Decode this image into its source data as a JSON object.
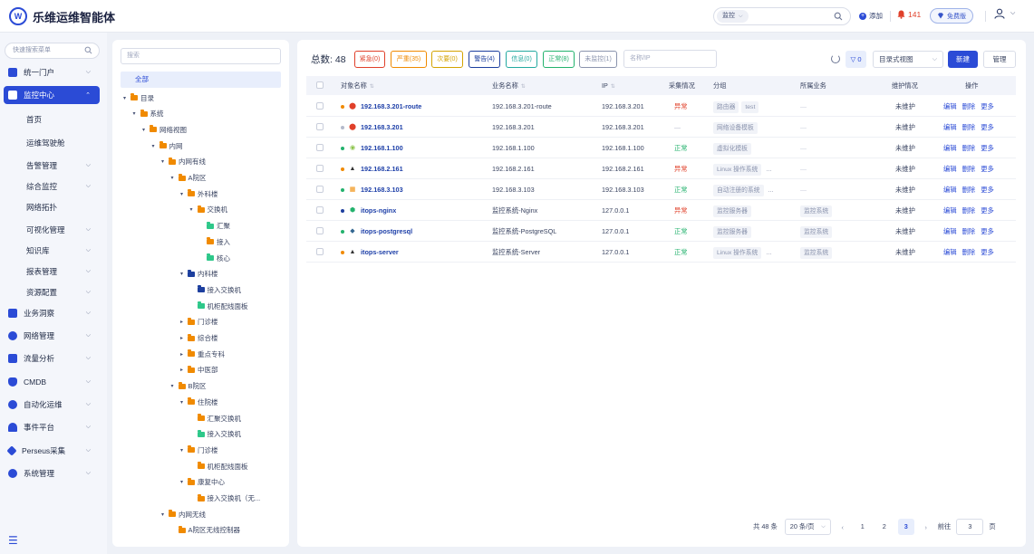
{
  "app": {
    "title": "乐维运维智能体",
    "logo_letter": "W"
  },
  "topbar": {
    "search_scope": "监控",
    "add_label": "添加",
    "alert_count": "141",
    "free_label": "免费版"
  },
  "leftnav": {
    "search_placeholder": "快速搜索菜单",
    "items": [
      {
        "label": "统一门户",
        "icon": "portal-icon",
        "has_children": true
      },
      {
        "label": "监控中心",
        "icon": "monitor-icon",
        "has_children": true,
        "active": true
      },
      {
        "label": "业务洞察",
        "icon": "insight-icon",
        "has_children": true
      },
      {
        "label": "网络管理",
        "icon": "network-icon",
        "has_children": true
      },
      {
        "label": "流量分析",
        "icon": "traffic-icon",
        "has_children": true
      },
      {
        "label": "CMDB",
        "icon": "cmdb-icon",
        "has_children": true
      },
      {
        "label": "自动化运维",
        "icon": "automation-icon",
        "has_children": true
      },
      {
        "label": "事件平台",
        "icon": "bell-icon",
        "has_children": true
      },
      {
        "label": "Perseus采集",
        "icon": "diamond-icon",
        "has_children": true
      },
      {
        "label": "系统管理",
        "icon": "gear-icon",
        "has_children": true
      }
    ],
    "sub_items": [
      {
        "label": "首页",
        "has_children": false
      },
      {
        "label": "运维驾驶舱",
        "has_children": false
      },
      {
        "label": "告警管理",
        "has_children": true
      },
      {
        "label": "综合监控",
        "has_children": true
      },
      {
        "label": "网络拓扑",
        "has_children": false
      },
      {
        "label": "可视化管理",
        "has_children": true
      },
      {
        "label": "知识库",
        "has_children": true
      },
      {
        "label": "报表管理",
        "has_children": true
      },
      {
        "label": "资源配置",
        "has_children": true
      }
    ]
  },
  "tree": {
    "search_placeholder": "搜索",
    "all_label": "全部",
    "nodes": [
      {
        "label": "目录",
        "level": 0,
        "expanded": true,
        "color": "orange"
      },
      {
        "label": "系统",
        "level": 1,
        "expanded": true,
        "color": "orange"
      },
      {
        "label": "网络视图",
        "level": 2,
        "expanded": true,
        "color": "orange"
      },
      {
        "label": "内网",
        "level": 3,
        "expanded": true,
        "color": "orange"
      },
      {
        "label": "内网有线",
        "level": 4,
        "expanded": true,
        "color": "orange"
      },
      {
        "label": "A院区",
        "level": 5,
        "expanded": true,
        "color": "orange"
      },
      {
        "label": "外科楼",
        "level": 6,
        "expanded": true,
        "color": "orange"
      },
      {
        "label": "交换机",
        "level": 7,
        "expanded": true,
        "color": "orange"
      },
      {
        "label": "汇聚",
        "level": 8,
        "expanded": null,
        "color": "green"
      },
      {
        "label": "接入",
        "level": 8,
        "expanded": null,
        "color": "orange"
      },
      {
        "label": "核心",
        "level": 8,
        "expanded": null,
        "color": "green"
      },
      {
        "label": "内科楼",
        "level": 6,
        "expanded": true,
        "color": "navy"
      },
      {
        "label": "接入交换机",
        "level": 7,
        "expanded": null,
        "color": "navy"
      },
      {
        "label": "机柜配线面板",
        "level": 7,
        "expanded": null,
        "color": "green"
      },
      {
        "label": "门诊楼",
        "level": 6,
        "expanded": false,
        "color": "orange"
      },
      {
        "label": "综合楼",
        "level": 6,
        "expanded": false,
        "color": "orange"
      },
      {
        "label": "重点专科",
        "level": 6,
        "expanded": false,
        "color": "orange"
      },
      {
        "label": "中医部",
        "level": 6,
        "expanded": false,
        "color": "orange"
      },
      {
        "label": "B院区",
        "level": 5,
        "expanded": true,
        "color": "orange"
      },
      {
        "label": "住院楼",
        "level": 6,
        "expanded": true,
        "color": "orange"
      },
      {
        "label": "汇聚交换机",
        "level": 7,
        "expanded": null,
        "color": "orange"
      },
      {
        "label": "接入交换机",
        "level": 7,
        "expanded": null,
        "color": "green"
      },
      {
        "label": "门诊楼",
        "level": 6,
        "expanded": true,
        "color": "orange"
      },
      {
        "label": "机柜配线面板",
        "level": 7,
        "expanded": null,
        "color": "orange"
      },
      {
        "label": "康复中心",
        "level": 6,
        "expanded": true,
        "color": "orange"
      },
      {
        "label": "接入交换机（无...",
        "level": 7,
        "expanded": null,
        "color": "orange"
      },
      {
        "label": "内网无线",
        "level": 4,
        "expanded": true,
        "color": "orange"
      },
      {
        "label": "A院区无线控制器",
        "level": 5,
        "expanded": null,
        "color": "orange"
      }
    ]
  },
  "main": {
    "total_label": "总数:",
    "total_value": "48",
    "filters": [
      {
        "label": "紧急(0)",
        "color": "#e0402a"
      },
      {
        "label": "严重(35)",
        "color": "#f08a00"
      },
      {
        "label": "次要(0)",
        "color": "#d4a300"
      },
      {
        "label": "警告(4)",
        "color": "#1d3f9e"
      },
      {
        "label": "信息(0)",
        "color": "#23a9a0"
      },
      {
        "label": "正常(8)",
        "color": "#23b26d"
      },
      {
        "label": "未监控(1)",
        "color": "#8a93ad"
      }
    ],
    "ip_placeholder": "名称/IP",
    "filter_count": "0",
    "view_select": "目录式视图",
    "new_label": "新建",
    "manage_label": "管理",
    "columns": [
      "对象名称",
      "业务名称",
      "IP",
      "采集情况",
      "分组",
      "所属业务",
      "维护情况",
      "操作"
    ],
    "rows": [
      {
        "name": "192.168.3.201-route",
        "dot": "#f08a00",
        "icon": "router-icon",
        "biz": "192.168.3.201-route",
        "ip": "192.168.3.201",
        "status": "异常",
        "status_kind": "bad",
        "groups": [
          "路由器",
          "test"
        ],
        "service": "—",
        "maint": "未维护"
      },
      {
        "name": "192.168.3.201",
        "dot": "#b4bacb",
        "icon": "router-icon",
        "biz": "192.168.3.201",
        "ip": "192.168.3.201",
        "status": "—",
        "status_kind": "none",
        "groups": [
          "网络设备模板"
        ],
        "service": "—",
        "maint": "未维护"
      },
      {
        "name": "192.168.1.100",
        "dot": "#23b26d",
        "icon": "vm-icon",
        "biz": "192.168.1.100",
        "ip": "192.168.1.100",
        "status": "正常",
        "status_kind": "ok",
        "groups": [
          "虚拟化模板"
        ],
        "service": "—",
        "maint": "未维护"
      },
      {
        "name": "192.168.2.161",
        "dot": "#f08a00",
        "icon": "linux-icon",
        "biz": "192.168.2.161",
        "ip": "192.168.2.161",
        "status": "异常",
        "status_kind": "bad",
        "groups": [
          "Linux 操作系统",
          "..."
        ],
        "service": "—",
        "maint": "未维护"
      },
      {
        "name": "192.168.3.103",
        "dot": "#23b26d",
        "icon": "windows-icon",
        "biz": "192.168.3.103",
        "ip": "192.168.3.103",
        "status": "正常",
        "status_kind": "ok",
        "groups": [
          "自动注册的系统",
          "..."
        ],
        "service": "—",
        "maint": "未维护"
      },
      {
        "name": "itops-nginx",
        "dot": "#1d3f9e",
        "icon": "nginx-icon",
        "biz": "监控系统-Nginx",
        "ip": "127.0.0.1",
        "status": "异常",
        "status_kind": "bad",
        "groups": [
          "监控服务器"
        ],
        "service": "监控系统",
        "maint": "未维护"
      },
      {
        "name": "itops-postgresql",
        "dot": "#23b26d",
        "icon": "postgresql-icon",
        "biz": "监控系统-PostgreSQL",
        "ip": "127.0.0.1",
        "status": "正常",
        "status_kind": "ok",
        "groups": [
          "监控服务器"
        ],
        "service": "监控系统",
        "maint": "未维护"
      },
      {
        "name": "itops-server",
        "dot": "#f08a00",
        "icon": "linux-icon",
        "biz": "监控系统-Server",
        "ip": "127.0.0.1",
        "status": "正常",
        "status_kind": "ok",
        "groups": [
          "Linux 操作系统",
          "..."
        ],
        "service": "监控系统",
        "maint": "未维护"
      }
    ],
    "row_actions": [
      "编辑",
      "删除",
      "更多"
    ],
    "pager": {
      "total_text": "共 48 条",
      "page_size": "20 条/页",
      "pages": [
        "1",
        "2",
        "3"
      ],
      "current_page": "3",
      "goto_label": "前往",
      "goto_value": "3",
      "page_unit": "页"
    }
  }
}
